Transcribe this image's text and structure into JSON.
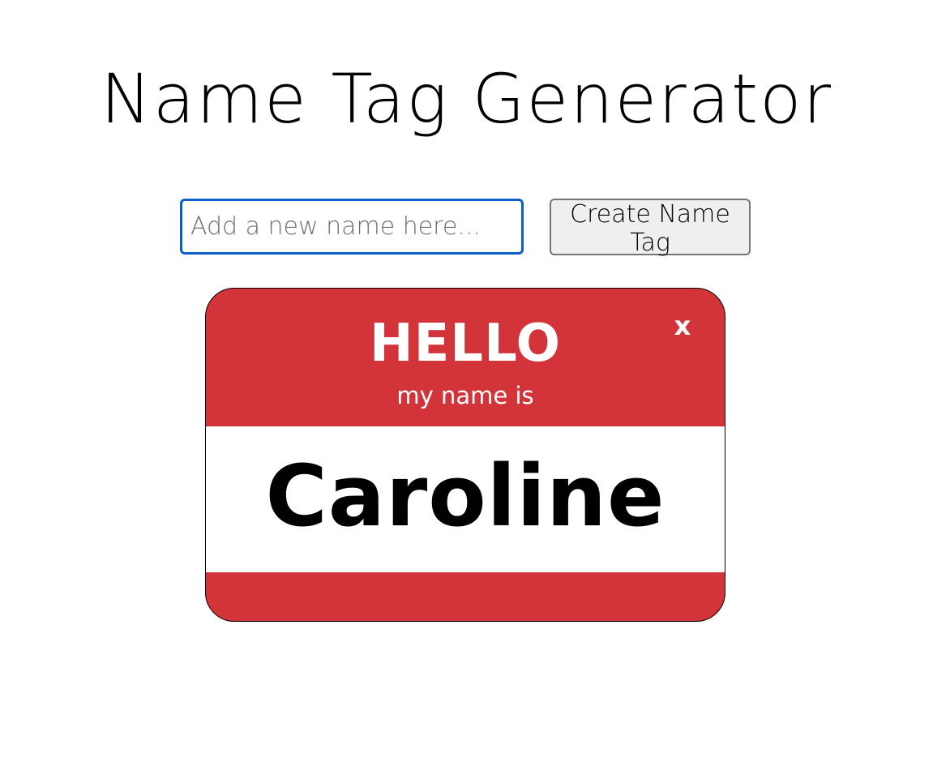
{
  "page": {
    "title": "Name Tag Generator"
  },
  "form": {
    "input_value": "",
    "input_placeholder": "Add a new name here...",
    "create_button_label": "Create Name Tag"
  },
  "name_tags": [
    {
      "greeting": "HELLO",
      "subtitle": "my name is",
      "name": "Caroline",
      "close_label": "x"
    }
  ],
  "colors": {
    "tag_red": "#d23439",
    "input_focus_border": "#0b5fc6",
    "button_background": "#efefef"
  }
}
